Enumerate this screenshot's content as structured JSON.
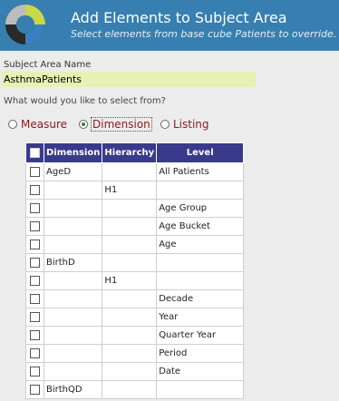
{
  "header": {
    "title": "Add Elements to Subject Area",
    "subtitle": "Select elements from base cube Patients to override."
  },
  "subject_area": {
    "label": "Subject Area Name",
    "value": "AsthmaPatients"
  },
  "question": "What would you like to select from?",
  "options": [
    {
      "label": "Measure",
      "selected": false
    },
    {
      "label": "Dimension",
      "selected": true
    },
    {
      "label": "Listing",
      "selected": false
    }
  ],
  "table": {
    "headers": [
      "Dimension",
      "Hierarchy",
      "Level"
    ],
    "rows": [
      {
        "dimension": "AgeD",
        "hierarchy": "",
        "level": "All Patients"
      },
      {
        "dimension": "",
        "hierarchy": "H1",
        "level": ""
      },
      {
        "dimension": "",
        "hierarchy": "",
        "level": "Age Group"
      },
      {
        "dimension": "",
        "hierarchy": "",
        "level": "Age Bucket"
      },
      {
        "dimension": "",
        "hierarchy": "",
        "level": "Age"
      },
      {
        "dimension": "BirthD",
        "hierarchy": "",
        "level": ""
      },
      {
        "dimension": "",
        "hierarchy": "H1",
        "level": ""
      },
      {
        "dimension": "",
        "hierarchy": "",
        "level": "Decade"
      },
      {
        "dimension": "",
        "hierarchy": "",
        "level": "Year"
      },
      {
        "dimension": "",
        "hierarchy": "",
        "level": "Quarter Year"
      },
      {
        "dimension": "",
        "hierarchy": "",
        "level": "Period"
      },
      {
        "dimension": "",
        "hierarchy": "",
        "level": "Date"
      },
      {
        "dimension": "BirthQD",
        "hierarchy": "",
        "level": ""
      }
    ]
  }
}
